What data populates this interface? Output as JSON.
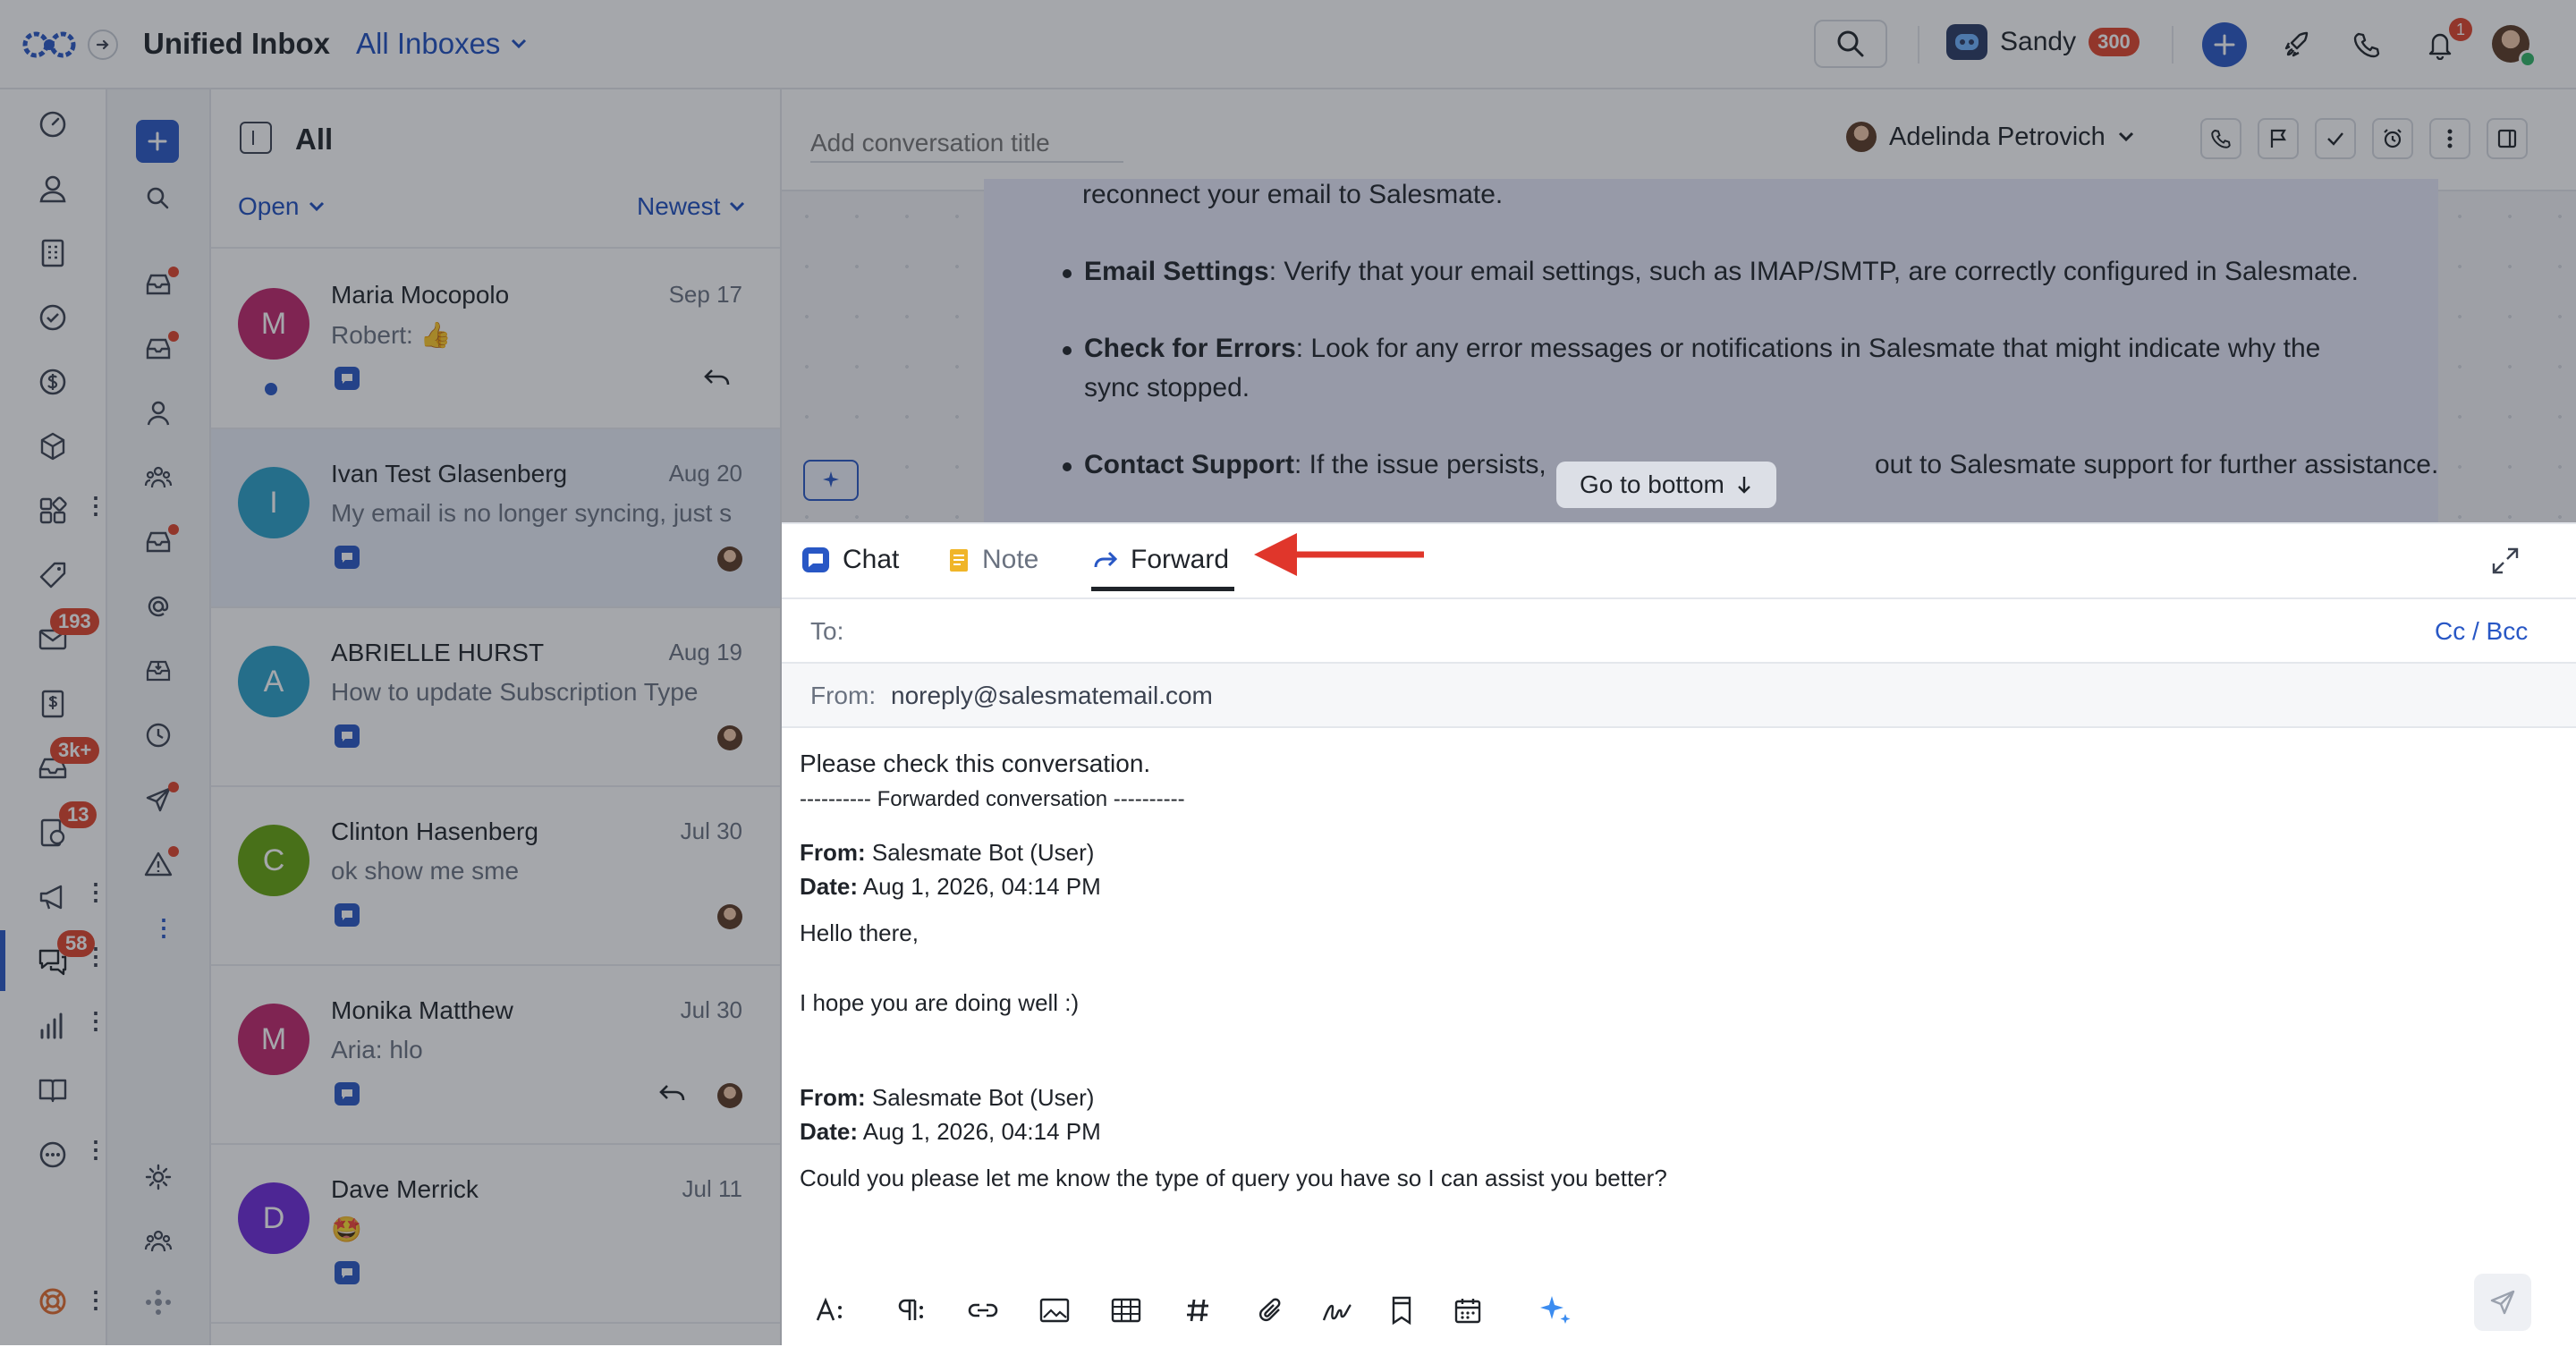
{
  "topbar": {
    "app_title": "Unified Inbox",
    "inbox_selector": "All Inboxes",
    "user_name": "Sandy",
    "user_count": "300",
    "notification_count": "1"
  },
  "rail": {
    "badges": {
      "email": "193",
      "inbox": "3k+",
      "tickets": "13",
      "chat": "58"
    }
  },
  "list": {
    "title": "All",
    "status_filter": "Open",
    "sort": "Newest",
    "conversations": [
      {
        "initial": "M",
        "name": "Maria Mocopolo",
        "date": "Sep 17",
        "preview": "Robert: 👍",
        "color": "#c0266b"
      },
      {
        "initial": "I",
        "name": "Ivan Test Glasenberg",
        "date": "Aug 20",
        "preview": "My email is no longer syncing, just s",
        "color": "#2aa1c9"
      },
      {
        "initial": "A",
        "name": "ABRIELLE HURST",
        "date": "Aug 19",
        "preview": "How to update Subscription Type",
        "color": "#2aa1c9"
      },
      {
        "initial": "C",
        "name": "Clinton Hasenberg",
        "date": "Jul 30",
        "preview": "ok show me sme",
        "color": "#65a30d"
      },
      {
        "initial": "M",
        "name": "Monika Matthew",
        "date": "Jul 30",
        "preview": "Aria: hlo",
        "color": "#c0266b"
      },
      {
        "initial": "D",
        "name": "Dave Merrick",
        "date": "Jul 11",
        "preview": "🤩",
        "color": "#6d28d9"
      }
    ]
  },
  "conversation": {
    "title_placeholder": "Add conversation title",
    "assignee": "Adelinda Petrovich",
    "messages": {
      "line0": "reconnect your email to Salesmate.",
      "b1_bold": "Email Settings",
      "b1_text": ": Verify that your email settings, such as IMAP/SMTP, are correctly configured in Salesmate.",
      "b2_bold": "Check for Errors",
      "b2_text": ": Look for any error messages or notifications in Salesmate that might indicate why the",
      "b2_text2": "sync stopped.",
      "b3_bold": "Contact Support",
      "b3_text_a": ": If the issue persists,",
      "b3_text_b": "out to Salesmate support for further assistance."
    },
    "go_to_bottom": "Go to bottom"
  },
  "composer": {
    "tabs": {
      "chat": "Chat",
      "note": "Note",
      "forward": "Forward"
    },
    "to_label": "To:",
    "cc_bcc": "Cc / Bcc",
    "from_label": "From:",
    "from_value": "noreply@salesmatemail.com",
    "body": {
      "intro": "Please check this conversation.",
      "separator": "---------- Forwarded conversation ----------",
      "from_label": "From:",
      "date_label": "Date:",
      "m1_from": " Salesmate Bot (User)",
      "m1_date": " Aug 1, 2026, 04:14 PM",
      "m1_line1": "Hello there,",
      "m1_line2": "I hope you are doing well :)",
      "m2_from": " Salesmate Bot (User)",
      "m2_date": " Aug 1, 2026, 04:14 PM",
      "m2_line1": "Could you please let me know the type of query you have so I can assist you better?"
    }
  },
  "colors": {
    "accent": "#2857c5",
    "badge": "#e0442b",
    "annotation_arrow": "#e0362b"
  }
}
